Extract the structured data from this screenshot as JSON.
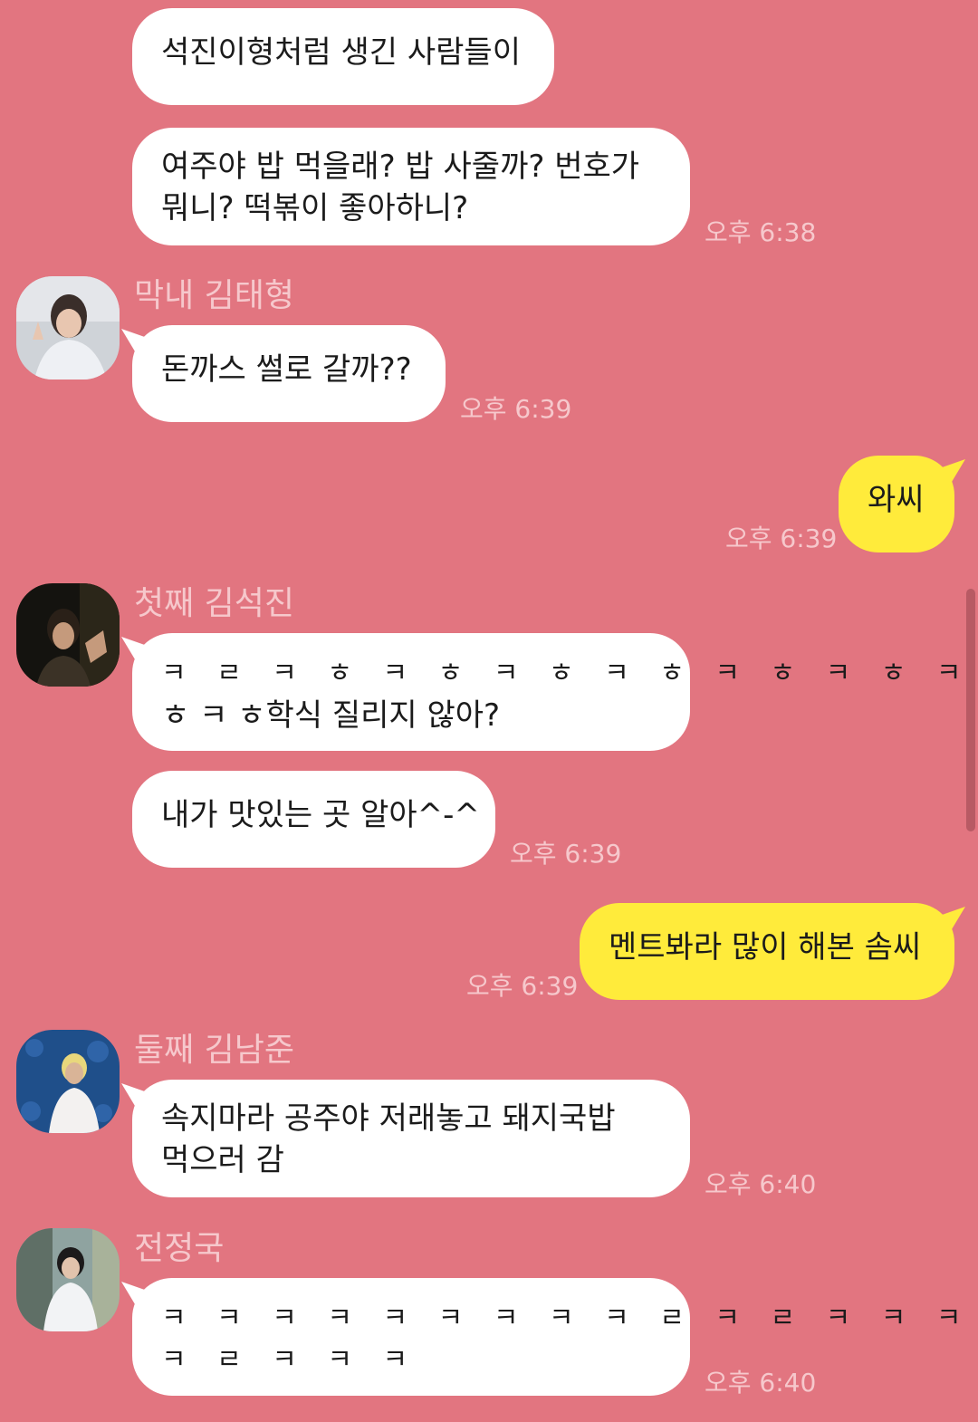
{
  "messages": [
    {
      "text": "석진이형처럼 생긴 사람들이"
    },
    {
      "lines": [
        "여주야 밥 먹을래? 밥 사줄까? 번호가",
        "뭐니? 떡볶이 좋아하니?"
      ],
      "time": "오후 6:38"
    },
    {
      "sender": "막내 김태형",
      "text": "돈까스 썰로 갈까??",
      "time": "오후 6:39"
    },
    {
      "text": "와씨",
      "time": "오후 6:39",
      "mine": true
    },
    {
      "sender": "첫째 김석진",
      "lines": [
        "ㅋ ㄹ ㅋ ㅎ ㅋ ㅎ ㅋ ㅎ ㅋ ㅎ ㅋ ㅎ ㅋ ㅎ ㅋ",
        "ㅎ ㅋ ㅎ학식 질리지 않아?"
      ]
    },
    {
      "text": "내가 맛있는 곳 알아^-^",
      "time": "오후 6:39"
    },
    {
      "text": "멘트봐라 많이 해본 솜씨",
      "time": "오후 6:39",
      "mine": true
    },
    {
      "sender": "둘째 김남준",
      "lines": [
        "속지마라 공주야 저래놓고 돼지국밥",
        "먹으러 감"
      ],
      "time": "오후 6:40"
    },
    {
      "sender": "전정국",
      "lines": [
        "ㅋ ㅋ ㅋ ㅋ ㅋ ㅋ ㅋ ㅋ ㅋ ㄹ ㅋ ㄹ ㅋ ㅋ ㅋ",
        "ㅋ ㄹ ㅋ ㅋ ㅋ"
      ],
      "time": "오후 6:40"
    }
  ],
  "colors": {
    "background": "#e27580",
    "bubble_incoming": "#ffffff",
    "bubble_outgoing": "#ffeb3b",
    "meta_text": "#f6c8cc"
  }
}
